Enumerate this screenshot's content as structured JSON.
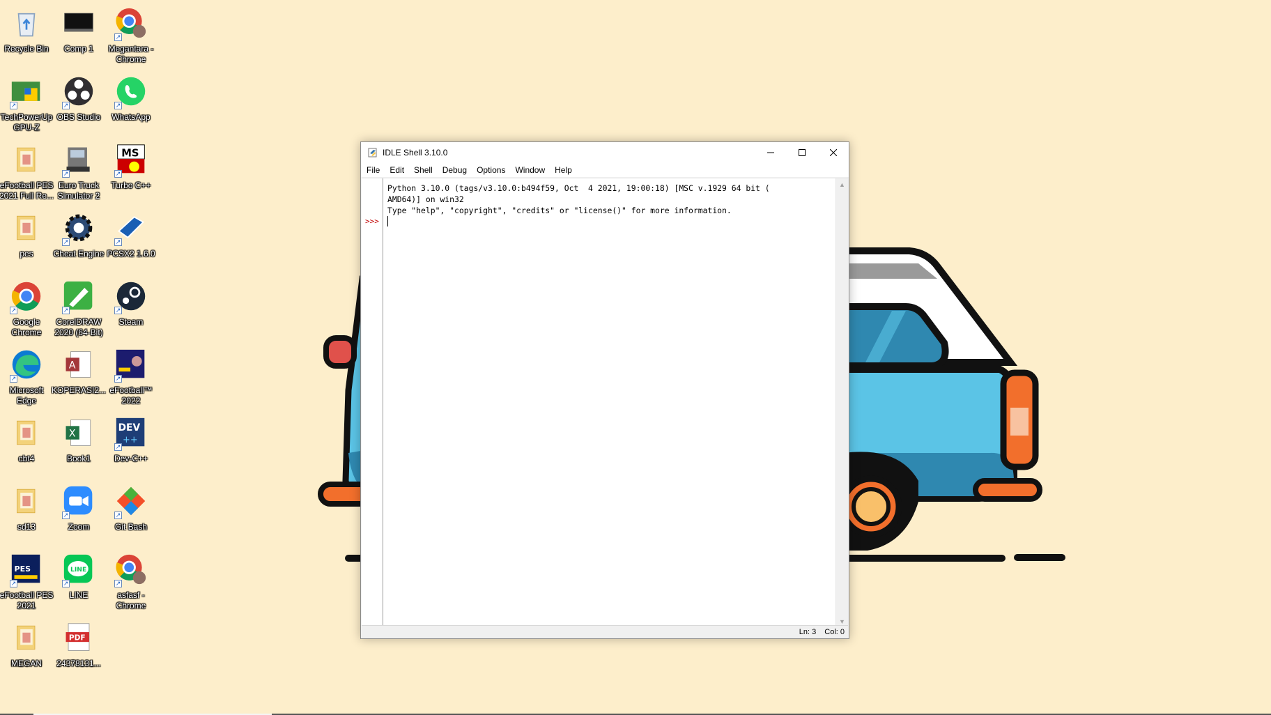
{
  "desktop": {
    "icons": [
      {
        "label": "Recycle Bin",
        "icon": "recycle-bin-icon"
      },
      {
        "label": "Comp 1",
        "icon": "video-file-icon"
      },
      {
        "label": "Megantara - Chrome",
        "icon": "chrome-profile-icon"
      },
      {
        "label": "TechPowerUp GPU-Z",
        "icon": "gpu-z-icon"
      },
      {
        "label": "OBS Studio",
        "icon": "obs-icon"
      },
      {
        "label": "WhatsApp",
        "icon": "whatsapp-icon"
      },
      {
        "label": "eFootball PES 2021 Full Re...",
        "icon": "folder-icon"
      },
      {
        "label": "Euro Truck Simulator 2",
        "icon": "truck-icon"
      },
      {
        "label": "Turbo C++",
        "icon": "turbo-cpp-icon"
      },
      {
        "label": "pes",
        "icon": "folder-icon"
      },
      {
        "label": "Cheat Engine",
        "icon": "cheat-engine-icon"
      },
      {
        "label": "PCSX2 1.6.0",
        "icon": "pcsx2-icon"
      },
      {
        "label": "Google Chrome",
        "icon": "chrome-icon"
      },
      {
        "label": "CorelDRAW 2020 (64-Bit)",
        "icon": "coreldraw-icon"
      },
      {
        "label": "Steam",
        "icon": "steam-icon"
      },
      {
        "label": "Microsoft Edge",
        "icon": "edge-icon"
      },
      {
        "label": "KOPERASI2...",
        "icon": "access-file-icon"
      },
      {
        "label": "eFootball™ 2022",
        "icon": "efootball-icon"
      },
      {
        "label": "cbt4",
        "icon": "folder-icon"
      },
      {
        "label": "Book1",
        "icon": "excel-file-icon"
      },
      {
        "label": "Dev-C++",
        "icon": "devcpp-icon"
      },
      {
        "label": "sd13",
        "icon": "folder-icon"
      },
      {
        "label": "Zoom",
        "icon": "zoom-icon"
      },
      {
        "label": "Git Bash",
        "icon": "git-bash-icon"
      },
      {
        "label": "eFootball PES 2021",
        "icon": "pes2021-icon"
      },
      {
        "label": "LINE",
        "icon": "line-icon"
      },
      {
        "label": "asfasf - Chrome",
        "icon": "chrome-profile-icon"
      },
      {
        "label": "MEGAN",
        "icon": "folder-icon"
      },
      {
        "label": "24378131...",
        "icon": "pdf-file-icon"
      }
    ]
  },
  "idle": {
    "title": "IDLE Shell 3.10.0",
    "menu": [
      "File",
      "Edit",
      "Shell",
      "Debug",
      "Options",
      "Window",
      "Help"
    ],
    "shell_text": "Python 3.10.0 (tags/v3.10.0:b494f59, Oct  4 2021, 19:00:18) [MSC v.1929 64 bit (\nAMD64)] on win32\nType \"help\", \"copyright\", \"credits\" or \"license()\" for more information.",
    "prompt": ">>>",
    "status_line": "Ln: 3",
    "status_col": "Col: 0"
  },
  "colors": {
    "wallpaper": "#fdeecb",
    "van_body": "#5bc4e6",
    "van_dark": "#2f88b0",
    "van_accent": "#f26f2c",
    "outline": "#111111",
    "prompt": "#c00000"
  }
}
